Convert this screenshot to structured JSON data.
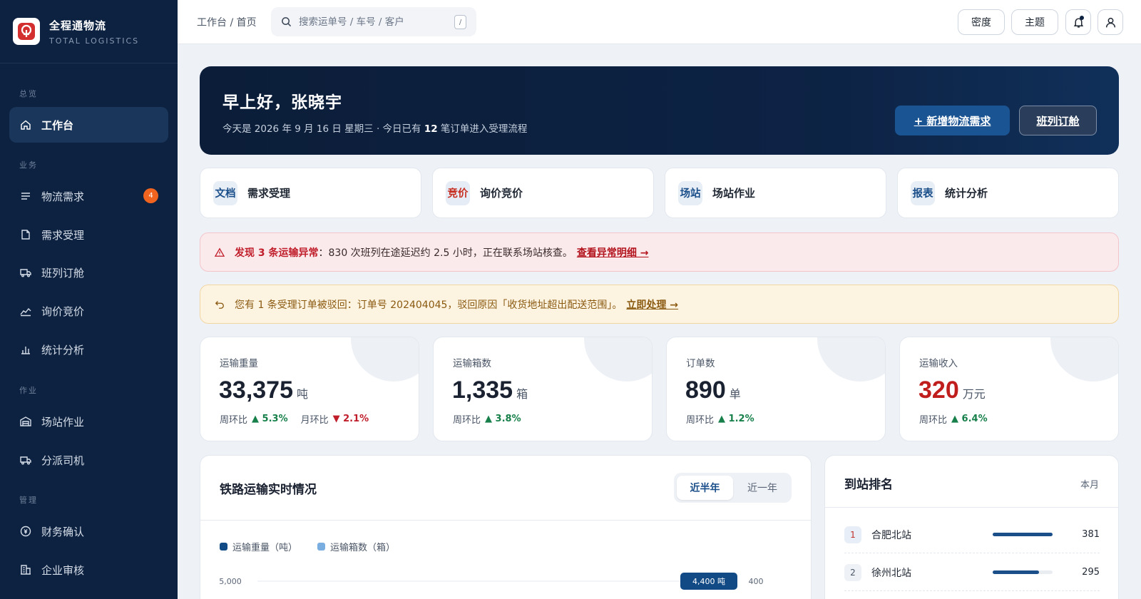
{
  "brand": {
    "name": "全程通物流",
    "sub": "TOTAL LOGISTICS"
  },
  "sidebar": {
    "sections": [
      "总览",
      "业务",
      "作业",
      "管理"
    ],
    "items": [
      {
        "label": "工作台",
        "icon": "home-icon"
      },
      {
        "label": "物流需求",
        "icon": "list-icon",
        "badge": "4"
      },
      {
        "label": "需求受理",
        "icon": "document-icon"
      },
      {
        "label": "班列订舱",
        "icon": "truck-icon"
      },
      {
        "label": "询价竞价",
        "icon": "trend-icon"
      },
      {
        "label": "统计分析",
        "icon": "bar-chart-icon"
      },
      {
        "label": "场站作业",
        "icon": "warehouse-icon"
      },
      {
        "label": "分派司机",
        "icon": "delivery-truck-icon"
      },
      {
        "label": "财务确认",
        "icon": "coin-icon"
      },
      {
        "label": "企业审核",
        "icon": "building-icon"
      }
    ]
  },
  "topbar": {
    "breadcrumb": "工作台 / 首页",
    "search_placeholder": "搜索运单号 / 车号 / 客户",
    "search_shortcut": "/",
    "density_label": "密度",
    "theme_label": "主题"
  },
  "hero": {
    "greeting": "早上好，张晓宇",
    "subtitle_prefix": "今天是 2026 年 9 月 16 日 星期三 · 今日已有 ",
    "order_count": "12",
    "subtitle_suffix": " 笔订单进入受理流程",
    "primary_button": "+ 新增物流需求",
    "secondary_button": "班列订舱"
  },
  "quick_links": [
    {
      "tag": "文档",
      "label": "需求受理"
    },
    {
      "tag": "竞价",
      "label": "询价竞价"
    },
    {
      "tag": "场站",
      "label": "场站作业"
    },
    {
      "tag": "报表",
      "label": "统计分析"
    }
  ],
  "alerts": {
    "exception": {
      "strong": "发现 3 条运输异常",
      "text": "：830 次班列在途延迟约 2.5 小时，正在联系场站核查。",
      "link": "查看异常明细 →"
    },
    "rejection": {
      "text": "您有 1 条受理订单被驳回：订单号 202404045，驳回原因「收货地址超出配送范围」。",
      "link": "立即处理 →"
    }
  },
  "stats": [
    {
      "label": "运输重量",
      "value": "33,375",
      "unit": "吨",
      "trend1_label": "周环比",
      "trend1": "▲ 5.3%",
      "trend2_label": "月环比",
      "trend2": "▼ 2.1%"
    },
    {
      "label": "运输箱数",
      "value": "1,335",
      "unit": "箱",
      "trend1_label": "周环比",
      "trend1": "▲ 3.8%"
    },
    {
      "label": "订单数",
      "value": "890",
      "unit": "单",
      "trend1_label": "周环比",
      "trend1": "▲ 1.2%"
    },
    {
      "label": "运输收入",
      "value": "320",
      "unit": "万元",
      "trend1_label": "周环比",
      "trend1": "▲ 6.4%"
    }
  ],
  "chart_panel": {
    "title": "铁路运输实时情况",
    "tabs": [
      "近半年",
      "近一年"
    ],
    "active_tab": "近半年"
  },
  "chart_data": {
    "type": "bar",
    "series": [
      {
        "name": "运输重量（吨）",
        "color": "#124a85"
      },
      {
        "name": "运输箱数（箱）",
        "color": "#7aaee0"
      }
    ],
    "y_left_ticks": [
      "5,000"
    ],
    "y_right_ticks": [
      "400"
    ],
    "tooltip": "4,400 吨",
    "ylim_left": [
      0,
      5000
    ],
    "ylim_right": [
      0,
      400
    ]
  },
  "ranking": {
    "title": "到站排名",
    "period": "本月",
    "max_value": 381,
    "rows": [
      {
        "rank": "1",
        "name": "合肥北站",
        "value": 381
      },
      {
        "rank": "2",
        "name": "徐州北站",
        "value": 295
      }
    ]
  },
  "colors": {
    "sidebar_bg": "#0d2240",
    "accent": "#1b5493",
    "danger": "#c01d2a",
    "success": "#17804a",
    "warning_text": "#8a5a10",
    "badge": "#f0641f"
  }
}
